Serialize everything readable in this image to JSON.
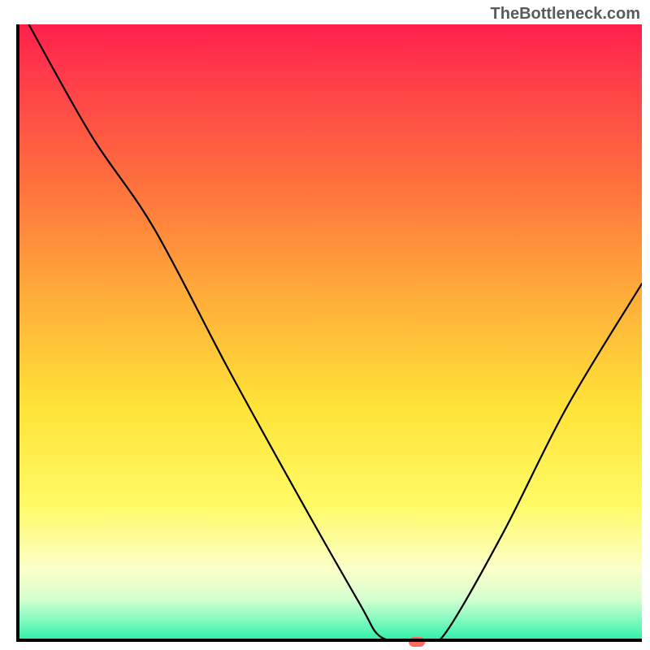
{
  "watermark": "TheBottleneck.com",
  "colors": {
    "top": "#ff1f4b",
    "mid": "#ffe338",
    "bottom": "#27f0a6",
    "marker": "#ff6b62",
    "axis": "#000000"
  },
  "chart_data": {
    "type": "line",
    "title": "",
    "xlabel": "",
    "ylabel": "",
    "xlim": [
      0,
      100
    ],
    "ylim": [
      0,
      100
    ],
    "series": [
      {
        "name": "bottleneck-curve",
        "points": [
          {
            "x": 2,
            "y": 100
          },
          {
            "x": 12,
            "y": 82
          },
          {
            "x": 22,
            "y": 67
          },
          {
            "x": 34,
            "y": 44
          },
          {
            "x": 46,
            "y": 22
          },
          {
            "x": 55,
            "y": 6
          },
          {
            "x": 58,
            "y": 1
          },
          {
            "x": 62,
            "y": 0
          },
          {
            "x": 66,
            "y": 0
          },
          {
            "x": 69,
            "y": 2
          },
          {
            "x": 78,
            "y": 18
          },
          {
            "x": 88,
            "y": 38
          },
          {
            "x": 100,
            "y": 58
          }
        ]
      }
    ],
    "marker": {
      "x": 64,
      "y": 0
    },
    "background_gradient": {
      "orientation": "vertical",
      "stops": [
        {
          "pos": 0,
          "color": "#ff1f4b"
        },
        {
          "pos": 0.25,
          "color": "#ff6e3d"
        },
        {
          "pos": 0.62,
          "color": "#ffe338"
        },
        {
          "pos": 0.88,
          "color": "#fcffc8"
        },
        {
          "pos": 1.0,
          "color": "#27f0a6"
        }
      ]
    }
  }
}
